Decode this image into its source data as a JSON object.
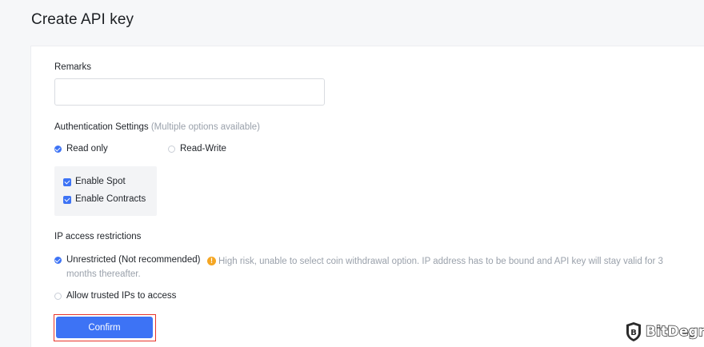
{
  "page": {
    "title": "Create API key"
  },
  "remarks": {
    "label": "Remarks",
    "value": "",
    "placeholder": ""
  },
  "auth": {
    "label": "Authentication Settings",
    "hint": "(Multiple options available)",
    "options": [
      {
        "label": "Read only",
        "selected": true
      },
      {
        "label": "Read-Write",
        "selected": false
      }
    ],
    "checks": [
      {
        "label": "Enable Spot",
        "checked": true
      },
      {
        "label": "Enable Contracts",
        "checked": true
      }
    ]
  },
  "ip": {
    "label": "IP access restrictions",
    "options": [
      {
        "label": "Unrestricted (Not recommended)",
        "selected": true,
        "warning_line1": "High risk, unable to select coin withdrawal option. IP address has to be bound and API key will stay valid for 3",
        "warning_line2": "months thereafter."
      },
      {
        "label": "Allow trusted IPs to access",
        "selected": false
      }
    ]
  },
  "confirm_label": "Confirm",
  "brand": {
    "name": "BitDegree"
  },
  "colors": {
    "accent": "#3d73f5",
    "warning": "#f5a623",
    "highlight": "#e8342b"
  }
}
